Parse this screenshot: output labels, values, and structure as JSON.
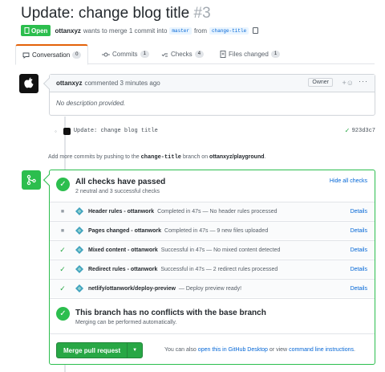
{
  "header": {
    "title": "Update: change blog title",
    "number": "#3",
    "state": "Open",
    "author": "ottanxyz",
    "merge_text": "wants to merge 1 commit into",
    "base_branch": "master",
    "from_text": "from",
    "head_branch": "change-title"
  },
  "tabs": [
    {
      "label": "Conversation",
      "count": "0",
      "icon": "comment-icon"
    },
    {
      "label": "Commits",
      "count": "1",
      "icon": "commit-icon"
    },
    {
      "label": "Checks",
      "count": "4",
      "icon": "checklist-icon"
    },
    {
      "label": "Files changed",
      "count": "1",
      "icon": "file-diff-icon"
    }
  ],
  "comment": {
    "author": "ottanxyz",
    "action": "commented 3 minutes ago",
    "role": "Owner",
    "reaction": "+☺",
    "menu": "···",
    "body": "No description provided."
  },
  "commit": {
    "message": "Update: change blog title",
    "sha": "923d3c7"
  },
  "push_note": {
    "prefix": "Add more commits by pushing to the",
    "branch": "change-title",
    "middle": "branch on",
    "repo": "ottanxyz/playground",
    "suffix": "."
  },
  "checks_summary": {
    "title": "All checks have passed",
    "subtitle": "2 neutral and 3 successful checks",
    "hide_label": "Hide all checks"
  },
  "checks": [
    {
      "status": "neutral",
      "name": "Header rules - ottanwork",
      "desc": "Completed in 47s — No header rules processed",
      "link": "Details"
    },
    {
      "status": "neutral",
      "name": "Pages changed - ottanwork",
      "desc": "Completed in 47s — 9 new files uploaded",
      "link": "Details"
    },
    {
      "status": "success",
      "name": "Mixed content - ottanwork",
      "desc": "Successful in 47s — No mixed content detected",
      "link": "Details"
    },
    {
      "status": "success",
      "name": "Redirect rules - ottanwork",
      "desc": "Successful in 47s — 2 redirect rules processed",
      "link": "Details"
    },
    {
      "status": "success",
      "name": "netlify/ottanwork/deploy-preview",
      "desc": "— Deploy preview ready!",
      "link": "Details"
    }
  ],
  "conflicts": {
    "title": "This branch has no conflicts with the base branch",
    "subtitle": "Merging can be performed automatically."
  },
  "merge": {
    "button_label": "Merge pull request",
    "hint_prefix": "You can also",
    "hint_link1": "open this in GitHub Desktop",
    "hint_middle": "or view",
    "hint_link2": "command line instructions",
    "hint_suffix": "."
  },
  "colors": {
    "success": "#2cbe4e",
    "link": "#0366d6",
    "tab_accent": "#e36209"
  }
}
